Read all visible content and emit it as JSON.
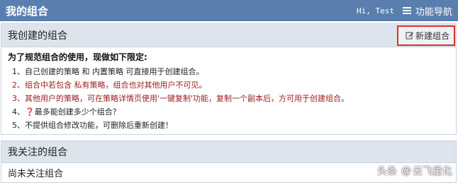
{
  "header": {
    "title": "我的组合",
    "greeting": "Hi, Test",
    "nav_label": "功能导航",
    "menu_icon": "hamburger-icon"
  },
  "created_panel": {
    "title": "我创建的组合",
    "new_button_label": "新建组合",
    "new_button_icon": "edit-icon",
    "rules_heading": "为了规范组合的使用，现做如下限定:",
    "rules": [
      "1、自己创建的策略 和 内置策略 可直接用于创建组合。",
      "2、组合中若包含 私有策略，组合也对其他用户不可见。",
      "3、其他用户的策略，可在策略详情页使用'一键复制'功能，复制一个副本后，方可用于创建组合。",
      "4、❓最多能创建多少个组合？",
      "5、不提供组合修改功能，可删除后重新创建！"
    ],
    "rule_colors": [
      "#222222",
      "#9b1b1b",
      "#9b1b1b",
      "#222222",
      "#222222"
    ]
  },
  "followed_panel": {
    "title": "我关注的组合",
    "empty_text": "尚未关注组合"
  },
  "watermark": {
    "logo": "头条",
    "at": "@",
    "name": "云飞量化"
  }
}
